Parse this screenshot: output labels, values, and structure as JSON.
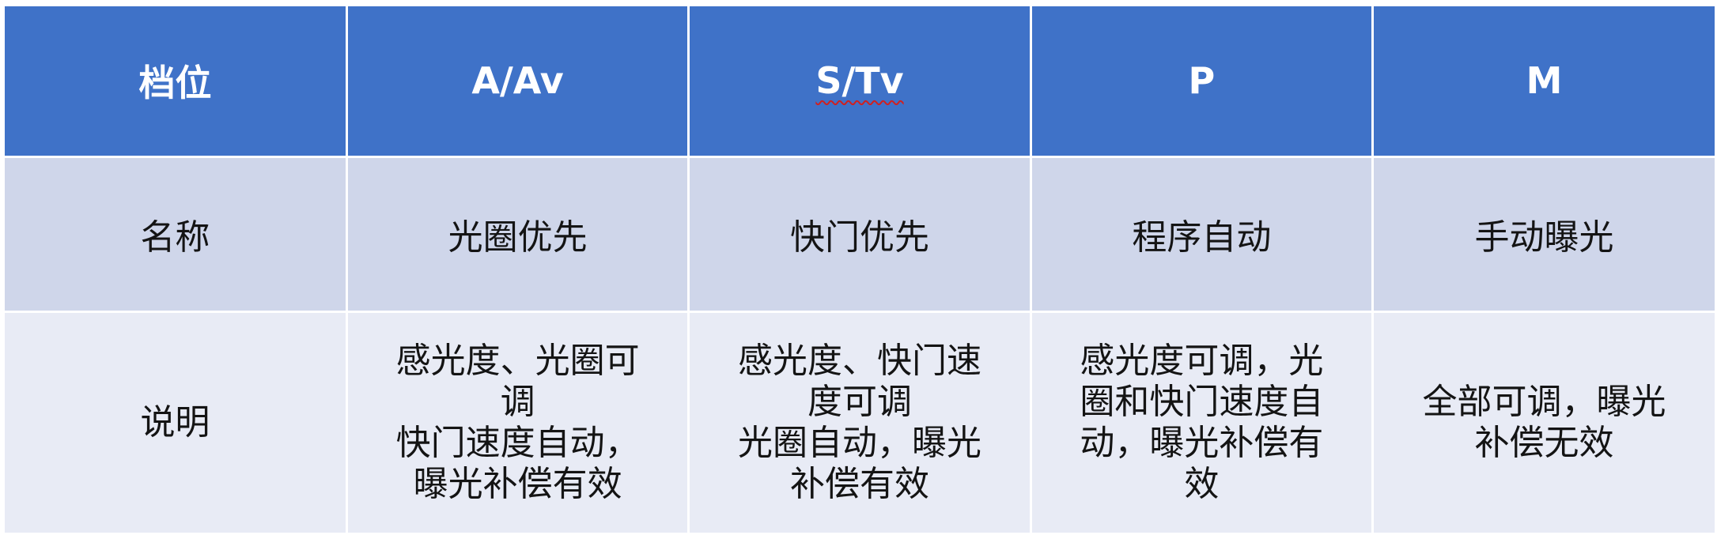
{
  "colors": {
    "header_bg": "#3f72c8",
    "header_text": "#ffffff",
    "row1_bg": "#cfd6ea",
    "row2_bg": "#e8ebf5",
    "body_text": "#141414"
  },
  "header": {
    "cells": [
      "档位",
      "A/Av",
      "S/Tv",
      "P",
      "M"
    ]
  },
  "rows": [
    {
      "label": "名称",
      "cells": [
        "光圈优先",
        "快门优先",
        "程序自动",
        "手动曝光"
      ]
    },
    {
      "label": "说明",
      "cells_lines": [
        [
          "感光度、光圈可",
          "调",
          "快门速度自动，",
          "曝光补偿有效"
        ],
        [
          "感光度、快门速",
          "度可调",
          "光圈自动，曝光",
          "补偿有效"
        ],
        [
          "感光度可调，光",
          "圈和快门速度自",
          "动，曝光补偿有",
          "效"
        ],
        [
          "全部可调，曝光",
          "补偿无效"
        ]
      ]
    }
  ]
}
